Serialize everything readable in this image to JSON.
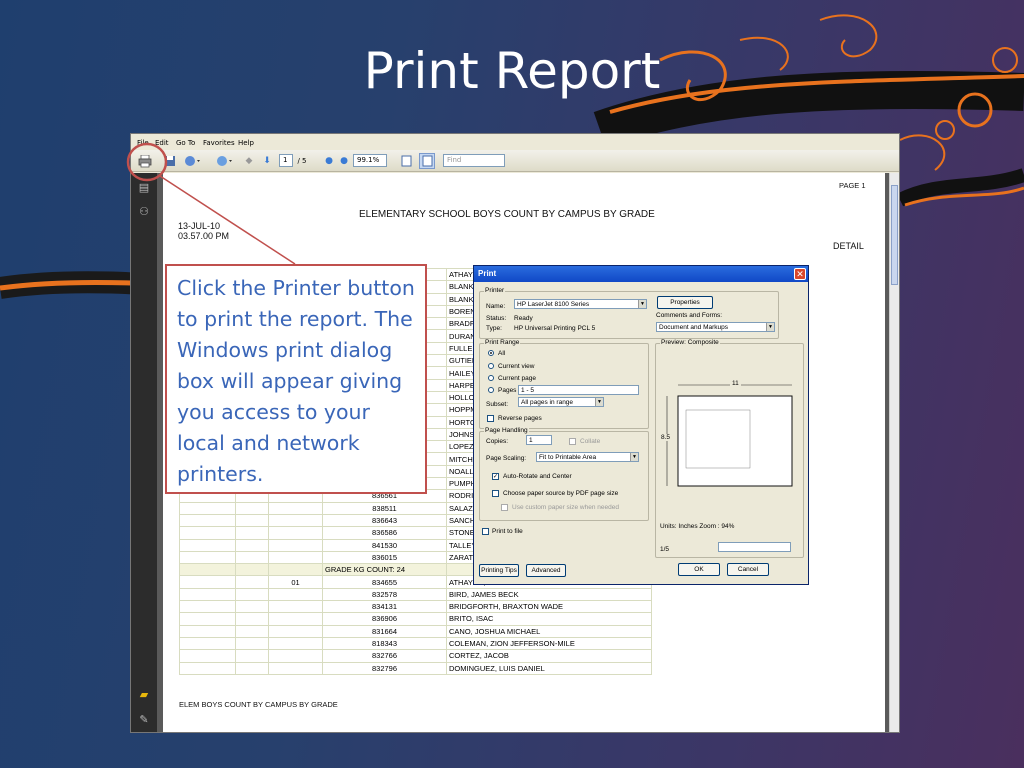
{
  "slide_title": "Print Report",
  "callout_text": "Click the Printer button to print the report. The Windows print dialog box will appear giving you access to your local and network printers.",
  "menu": [
    "File",
    "Edit",
    "Go To",
    "Favorites",
    "Help"
  ],
  "toolbar": {
    "page_current": "1",
    "page_total": "/ 5",
    "zoom": "99.1%",
    "find_placeholder": "Find"
  },
  "report": {
    "page_label": "PAGE 1",
    "title": "ELEMENTARY SCHOOL BOYS COUNT BY CAMPUS BY GRADE",
    "date": "13-JUL-10",
    "time": "03.57.00 PM",
    "detail_label": "DETAIL",
    "footer": "ELEM BOYS COUNT BY CAMPUS BY GRADE"
  },
  "table_rows_top": [
    {
      "id": "",
      "name": "ATHAYD"
    },
    {
      "id": "",
      "name": "BLANK,"
    },
    {
      "id": "",
      "name": "BLANK,"
    },
    {
      "id": "",
      "name": "BOREN"
    },
    {
      "id": "",
      "name": "BRADF("
    },
    {
      "id": "",
      "name": "DURAN"
    },
    {
      "id": "",
      "name": "FULLER"
    },
    {
      "id": "",
      "name": "GUTIER"
    },
    {
      "id": "",
      "name": "HAILEY"
    },
    {
      "id": "",
      "name": "HARPE"
    },
    {
      "id": "",
      "name": "HOLLO"
    },
    {
      "id": "",
      "name": "HOPPM"
    },
    {
      "id": "",
      "name": "HORTO"
    },
    {
      "id": "",
      "name": "JOHNS("
    },
    {
      "id": "",
      "name": "LOPEZ,"
    },
    {
      "id": "",
      "name": "MITCHE"
    },
    {
      "id": "",
      "name": "NOALL,"
    },
    {
      "id": "",
      "name": "PUMPH"
    },
    {
      "id": "836561",
      "name": "RODRIG"
    },
    {
      "id": "838511",
      "name": "SALAZA"
    },
    {
      "id": "836643",
      "name": "SANCH"
    },
    {
      "id": "836586",
      "name": "STONE,"
    },
    {
      "id": "841530",
      "name": "TALLEY"
    },
    {
      "id": "836015",
      "name": "ZARATE"
    }
  ],
  "grade_count": "GRADE KG COUNT: 24",
  "table_rows_bottom": [
    {
      "grade": "01",
      "id": "834655",
      "name": "ATHAYDE, ERIK RYAN"
    },
    {
      "grade": "",
      "id": "832578",
      "name": "BIRD, JAMES BECK"
    },
    {
      "grade": "",
      "id": "834131",
      "name": "BRIDGFORTH, BRAXTON WADE"
    },
    {
      "grade": "",
      "id": "836906",
      "name": "BRITO, ISAC"
    },
    {
      "grade": "",
      "id": "831664",
      "name": "CANO, JOSHUA MICHAEL"
    },
    {
      "grade": "",
      "id": "818343",
      "name": "COLEMAN, ZION JEFFERSON-MILE"
    },
    {
      "grade": "",
      "id": "832766",
      "name": "CORTEZ, JACOB"
    },
    {
      "grade": "",
      "id": "832796",
      "name": "DOMINGUEZ, LUIS DANIEL"
    }
  ],
  "print_dialog": {
    "title": "Print",
    "printer_group": "Printer",
    "name_label": "Name:",
    "name_value": "HP LaserJet 8100 Series",
    "properties_button": "Properties",
    "status_label": "Status:",
    "status_value": "Ready",
    "type_label": "Type:",
    "type_value": "HP Universal Printing PCL 5",
    "comments_label": "Comments and Forms:",
    "comments_value": "Document and Markups",
    "print_range_group": "Print Range",
    "range_all": "All",
    "range_current_view": "Current view",
    "range_current_page": "Current page",
    "range_pages": "Pages",
    "pages_value": "1 - 5",
    "subset_label": "Subset:",
    "subset_value": "All pages in range",
    "reverse_pages": "Reverse pages",
    "page_handling_group": "Page Handling",
    "copies_label": "Copies:",
    "copies_value": "1",
    "collate": "Collate",
    "scaling_label": "Page Scaling:",
    "scaling_value": "Fit to Printable Area",
    "auto_rotate": "Auto-Rotate and Center",
    "choose_source": "Choose paper source by PDF page size",
    "custom_paper": "Use custom paper size when needed",
    "print_to_file": "Print to file",
    "preview_label": "Preview: Composite",
    "preview_width": "11",
    "preview_height": "8.5",
    "units_zoom": "Units: Inches Zoom :  94%",
    "page_indicator": "1/5",
    "printing_tips_button": "Printing Tips",
    "advanced_button": "Advanced",
    "ok_button": "OK",
    "cancel_button": "Cancel"
  }
}
